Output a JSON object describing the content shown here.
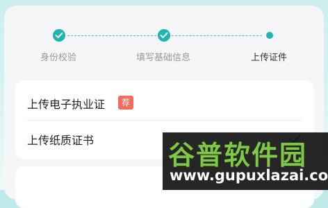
{
  "stepper": {
    "steps": [
      {
        "label": "身份校验",
        "status": "done"
      },
      {
        "label": "填写基础信息",
        "status": "done"
      },
      {
        "label": "上传证件",
        "status": "current"
      }
    ]
  },
  "upload_list": {
    "items": [
      {
        "label": "上传电子执业证",
        "badge": "荐"
      },
      {
        "label": "上传纸质证书"
      }
    ]
  },
  "watermark": {
    "title": "谷普软件园",
    "url": "www.gupuxlazai.com"
  },
  "colors": {
    "accent": "#1fb3b3",
    "badge": "#f26b5b",
    "watermark_green": "#7ec843"
  }
}
